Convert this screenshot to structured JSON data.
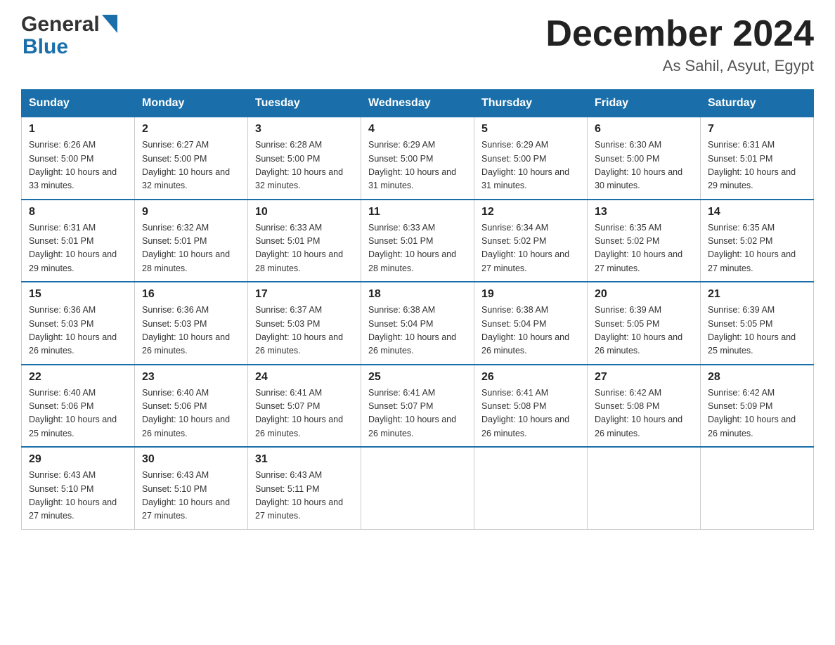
{
  "header": {
    "logo": {
      "general": "General",
      "blue": "Blue"
    },
    "title": "December 2024",
    "location": "As Sahil, Asyut, Egypt"
  },
  "days_of_week": [
    "Sunday",
    "Monday",
    "Tuesday",
    "Wednesday",
    "Thursday",
    "Friday",
    "Saturday"
  ],
  "weeks": [
    [
      {
        "day": 1,
        "sunrise": "6:26 AM",
        "sunset": "5:00 PM",
        "daylight": "10 hours and 33 minutes."
      },
      {
        "day": 2,
        "sunrise": "6:27 AM",
        "sunset": "5:00 PM",
        "daylight": "10 hours and 32 minutes."
      },
      {
        "day": 3,
        "sunrise": "6:28 AM",
        "sunset": "5:00 PM",
        "daylight": "10 hours and 32 minutes."
      },
      {
        "day": 4,
        "sunrise": "6:29 AM",
        "sunset": "5:00 PM",
        "daylight": "10 hours and 31 minutes."
      },
      {
        "day": 5,
        "sunrise": "6:29 AM",
        "sunset": "5:00 PM",
        "daylight": "10 hours and 31 minutes."
      },
      {
        "day": 6,
        "sunrise": "6:30 AM",
        "sunset": "5:00 PM",
        "daylight": "10 hours and 30 minutes."
      },
      {
        "day": 7,
        "sunrise": "6:31 AM",
        "sunset": "5:01 PM",
        "daylight": "10 hours and 29 minutes."
      }
    ],
    [
      {
        "day": 8,
        "sunrise": "6:31 AM",
        "sunset": "5:01 PM",
        "daylight": "10 hours and 29 minutes."
      },
      {
        "day": 9,
        "sunrise": "6:32 AM",
        "sunset": "5:01 PM",
        "daylight": "10 hours and 28 minutes."
      },
      {
        "day": 10,
        "sunrise": "6:33 AM",
        "sunset": "5:01 PM",
        "daylight": "10 hours and 28 minutes."
      },
      {
        "day": 11,
        "sunrise": "6:33 AM",
        "sunset": "5:01 PM",
        "daylight": "10 hours and 28 minutes."
      },
      {
        "day": 12,
        "sunrise": "6:34 AM",
        "sunset": "5:02 PM",
        "daylight": "10 hours and 27 minutes."
      },
      {
        "day": 13,
        "sunrise": "6:35 AM",
        "sunset": "5:02 PM",
        "daylight": "10 hours and 27 minutes."
      },
      {
        "day": 14,
        "sunrise": "6:35 AM",
        "sunset": "5:02 PM",
        "daylight": "10 hours and 27 minutes."
      }
    ],
    [
      {
        "day": 15,
        "sunrise": "6:36 AM",
        "sunset": "5:03 PM",
        "daylight": "10 hours and 26 minutes."
      },
      {
        "day": 16,
        "sunrise": "6:36 AM",
        "sunset": "5:03 PM",
        "daylight": "10 hours and 26 minutes."
      },
      {
        "day": 17,
        "sunrise": "6:37 AM",
        "sunset": "5:03 PM",
        "daylight": "10 hours and 26 minutes."
      },
      {
        "day": 18,
        "sunrise": "6:38 AM",
        "sunset": "5:04 PM",
        "daylight": "10 hours and 26 minutes."
      },
      {
        "day": 19,
        "sunrise": "6:38 AM",
        "sunset": "5:04 PM",
        "daylight": "10 hours and 26 minutes."
      },
      {
        "day": 20,
        "sunrise": "6:39 AM",
        "sunset": "5:05 PM",
        "daylight": "10 hours and 26 minutes."
      },
      {
        "day": 21,
        "sunrise": "6:39 AM",
        "sunset": "5:05 PM",
        "daylight": "10 hours and 25 minutes."
      }
    ],
    [
      {
        "day": 22,
        "sunrise": "6:40 AM",
        "sunset": "5:06 PM",
        "daylight": "10 hours and 25 minutes."
      },
      {
        "day": 23,
        "sunrise": "6:40 AM",
        "sunset": "5:06 PM",
        "daylight": "10 hours and 26 minutes."
      },
      {
        "day": 24,
        "sunrise": "6:41 AM",
        "sunset": "5:07 PM",
        "daylight": "10 hours and 26 minutes."
      },
      {
        "day": 25,
        "sunrise": "6:41 AM",
        "sunset": "5:07 PM",
        "daylight": "10 hours and 26 minutes."
      },
      {
        "day": 26,
        "sunrise": "6:41 AM",
        "sunset": "5:08 PM",
        "daylight": "10 hours and 26 minutes."
      },
      {
        "day": 27,
        "sunrise": "6:42 AM",
        "sunset": "5:08 PM",
        "daylight": "10 hours and 26 minutes."
      },
      {
        "day": 28,
        "sunrise": "6:42 AM",
        "sunset": "5:09 PM",
        "daylight": "10 hours and 26 minutes."
      }
    ],
    [
      {
        "day": 29,
        "sunrise": "6:43 AM",
        "sunset": "5:10 PM",
        "daylight": "10 hours and 27 minutes."
      },
      {
        "day": 30,
        "sunrise": "6:43 AM",
        "sunset": "5:10 PM",
        "daylight": "10 hours and 27 minutes."
      },
      {
        "day": 31,
        "sunrise": "6:43 AM",
        "sunset": "5:11 PM",
        "daylight": "10 hours and 27 minutes."
      },
      null,
      null,
      null,
      null
    ]
  ]
}
